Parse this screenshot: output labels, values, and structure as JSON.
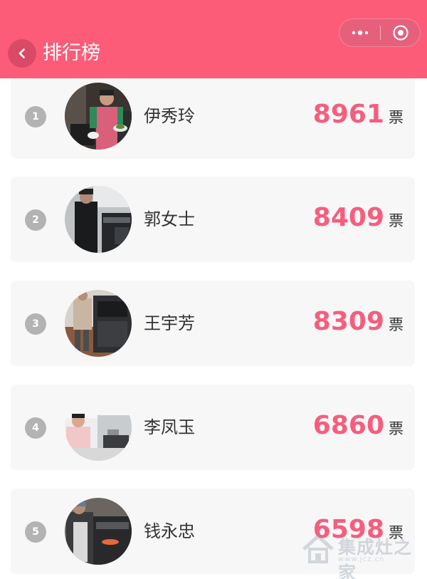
{
  "header": {
    "title": "排行榜",
    "color": "#fc5c78",
    "back_icon": "chevron-left-icon",
    "more_icon": "more-dots-icon",
    "close_icon": "target-close-icon"
  },
  "ranking": [
    {
      "rank": "1",
      "name": "伊秀玲",
      "votes": "8961",
      "unit": "票"
    },
    {
      "rank": "2",
      "name": "郭女士",
      "votes": "8409",
      "unit": "票"
    },
    {
      "rank": "3",
      "name": "王宇芳",
      "votes": "8309",
      "unit": "票"
    },
    {
      "rank": "4",
      "name": "李凤玉",
      "votes": "6860",
      "unit": "票"
    },
    {
      "rank": "5",
      "name": "钱永忠",
      "votes": "6598",
      "unit": "票"
    }
  ],
  "accent_color": "#f65e7d",
  "watermark": {
    "text": "集成灶之家",
    "url": "www.jcz.cn"
  }
}
